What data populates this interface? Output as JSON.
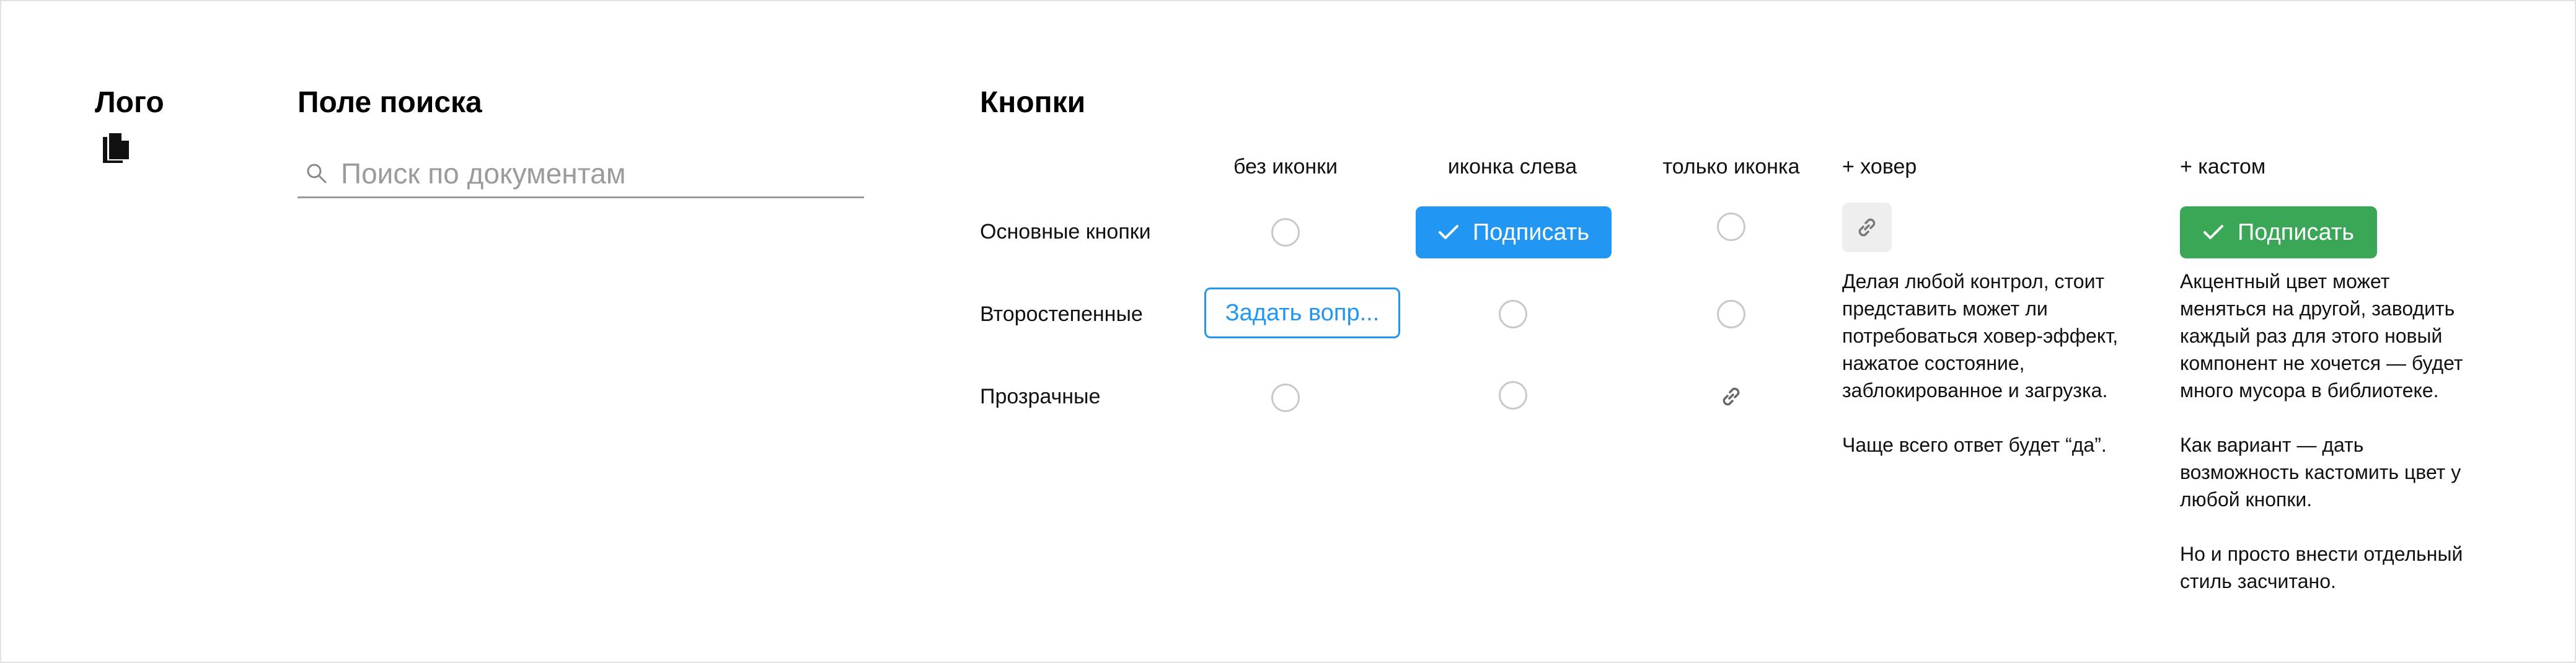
{
  "logo": {
    "title": "Лого",
    "icon": "document-copy-icon"
  },
  "search": {
    "title": "Поле поиска",
    "placeholder": "Поиск по документам",
    "icon": "search-icon"
  },
  "buttons": {
    "title": "Кнопки",
    "columns": [
      "без иконки",
      "иконка слева",
      "только иконка",
      "+ ховер",
      "+ кастом"
    ],
    "rows": [
      "Основные кнопки",
      "Второстепенные",
      "Прозрачные"
    ],
    "primary_icon_left_label": "Подписать",
    "secondary_no_icon_label": "Задать вопр...",
    "custom_label": "Подписать",
    "hover_icon": "link-icon",
    "colors": {
      "accent": "#2196f3",
      "custom_accent": "#3aa757",
      "placeholder_ring": "#c9c9c9"
    }
  },
  "notes": {
    "hover": "Делая любой контрол, стоит\nпредставить может ли\nпотребоваться ховер-эффект,\nнажатое состояние,\nзаблокированное и загрузка.\n\nЧаще всего ответ будет “да”.",
    "custom": "Акцентный цвет может\nменяться на другой, заводить\nкаждый раз для этого новый\nкомпонент не хочется — будет\nмного мусора в библиотеке.\n\nКак вариант — дать\nвозможность кастомить цвет у\nлюбой кнопки.\n\nНо и просто внести отдельный\nстиль засчитано."
  }
}
